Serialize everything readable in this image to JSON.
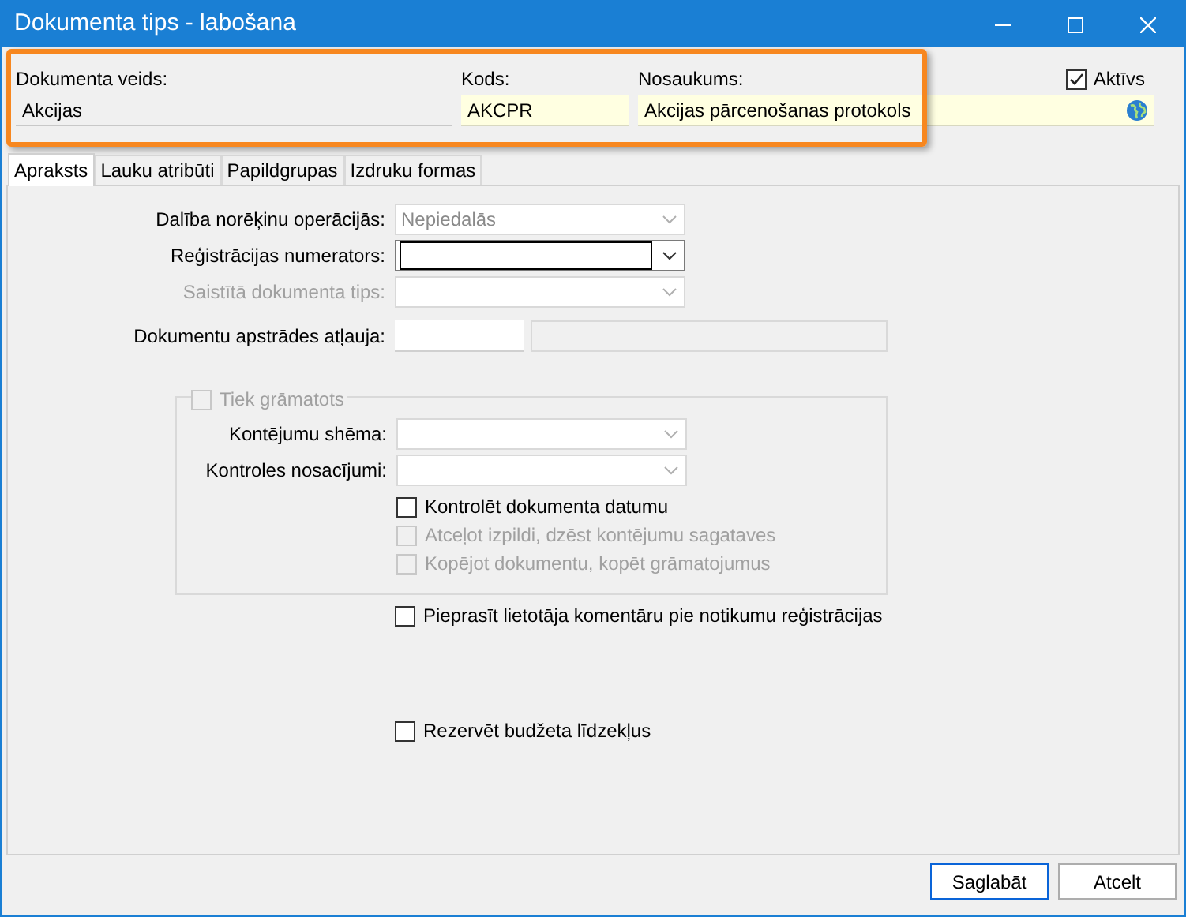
{
  "window": {
    "title": "Dokumenta tips - labošana"
  },
  "header": {
    "highlighted": true,
    "fields": [
      {
        "label": "Dokumenta veids:",
        "value": "Akcijas",
        "kind": "readonly"
      },
      {
        "label": "Kods:",
        "value": "AKCPR",
        "kind": "required"
      },
      {
        "label": "Nosaukums:",
        "value": "Akcijas pārcenošanas protokols",
        "kind": "translatable"
      }
    ],
    "active": {
      "label": "Aktīvs",
      "checked": true
    }
  },
  "tabs": [
    {
      "label": "Apraksts",
      "selected": true
    },
    {
      "label": "Lauku atribūti",
      "selected": false
    },
    {
      "label": "Papildgrupas",
      "selected": false
    },
    {
      "label": "Izdruku formas",
      "selected": false
    }
  ],
  "form": {
    "rows": [
      {
        "label": "Dalība norēķinu operācijās:",
        "kind": "combo",
        "value": "Nepiedalās",
        "readonly": true,
        "disabled": false,
        "focused": false
      },
      {
        "label": "Reģistrācijas numerators:",
        "kind": "combo",
        "disabled": false,
        "focused": true
      },
      {
        "label": "Saistītā dokumenta tips:",
        "kind": "combo",
        "disabled": true,
        "focused": false
      },
      {
        "label": "Dokumentu apstrādes atļauja:",
        "kind": "double",
        "disabled": false,
        "focused": false
      }
    ],
    "group": {
      "label": "Tiek grāmatots",
      "checked": false,
      "disabled": true,
      "rows": [
        {
          "label": "Kontējumu shēma:",
          "kind": "combo",
          "disabled": false,
          "focused": false
        },
        {
          "label": "Kontroles nosacījumi:",
          "kind": "combo",
          "disabled": false,
          "focused": false
        }
      ],
      "checks": [
        {
          "label": "Kontrolēt dokumenta datumu",
          "checked": false,
          "disabled": false
        },
        {
          "label": "Atceļot izpildi, dzēst kontējumu sagataves",
          "checked": false,
          "disabled": true
        },
        {
          "label": "Kopējot dokumentu, kopēt grāmatojumus",
          "checked": false,
          "disabled": true
        }
      ]
    },
    "checks": [
      {
        "label": "Pieprasīt lietotāja komentāru pie notikumu reģistrācijas",
        "checked": false,
        "disabled": false
      },
      {
        "label": "Rezervēt budžeta līdzekļus",
        "checked": false,
        "disabled": false
      }
    ]
  },
  "buttons": [
    {
      "label": "Saglabāt",
      "default": true
    },
    {
      "label": "Atcelt",
      "default": false
    }
  ]
}
